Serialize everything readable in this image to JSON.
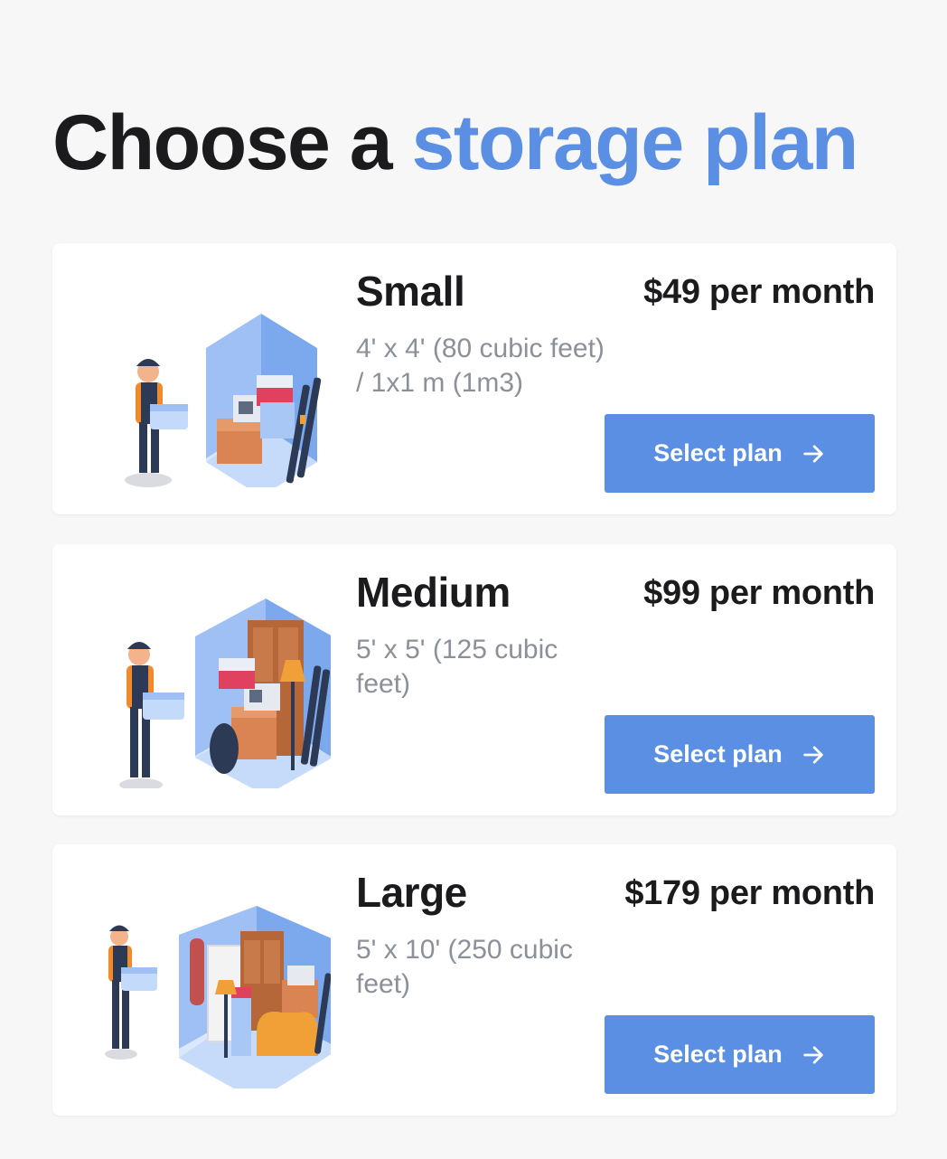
{
  "header": {
    "title_prefix": "Choose a",
    "title_accent": "storage plan"
  },
  "plans": [
    {
      "name": "Small",
      "price": "$49 per month",
      "dims": "4' x 4' (80 cubic feet) / 1x1 m (1m3)",
      "button_label": "Select plan",
      "illustration": "small-storage-unit-illustration"
    },
    {
      "name": "Medium",
      "price": "$99 per month",
      "dims": "5' x 5' (125 cubic feet)",
      "button_label": "Select plan",
      "illustration": "medium-storage-unit-illustration"
    },
    {
      "name": "Large",
      "price": "$179 per month",
      "dims": "5' x 10' (250 cubic feet)",
      "button_label": "Select plan",
      "illustration": "large-storage-unit-illustration"
    }
  ],
  "colors": {
    "accent": "#5b8fe3",
    "background": "#f7f7f7",
    "card": "#ffffff",
    "text": "#1b1b1d",
    "muted": "#8b9099"
  },
  "icons": {
    "button_icon": "arrow-right-icon"
  }
}
